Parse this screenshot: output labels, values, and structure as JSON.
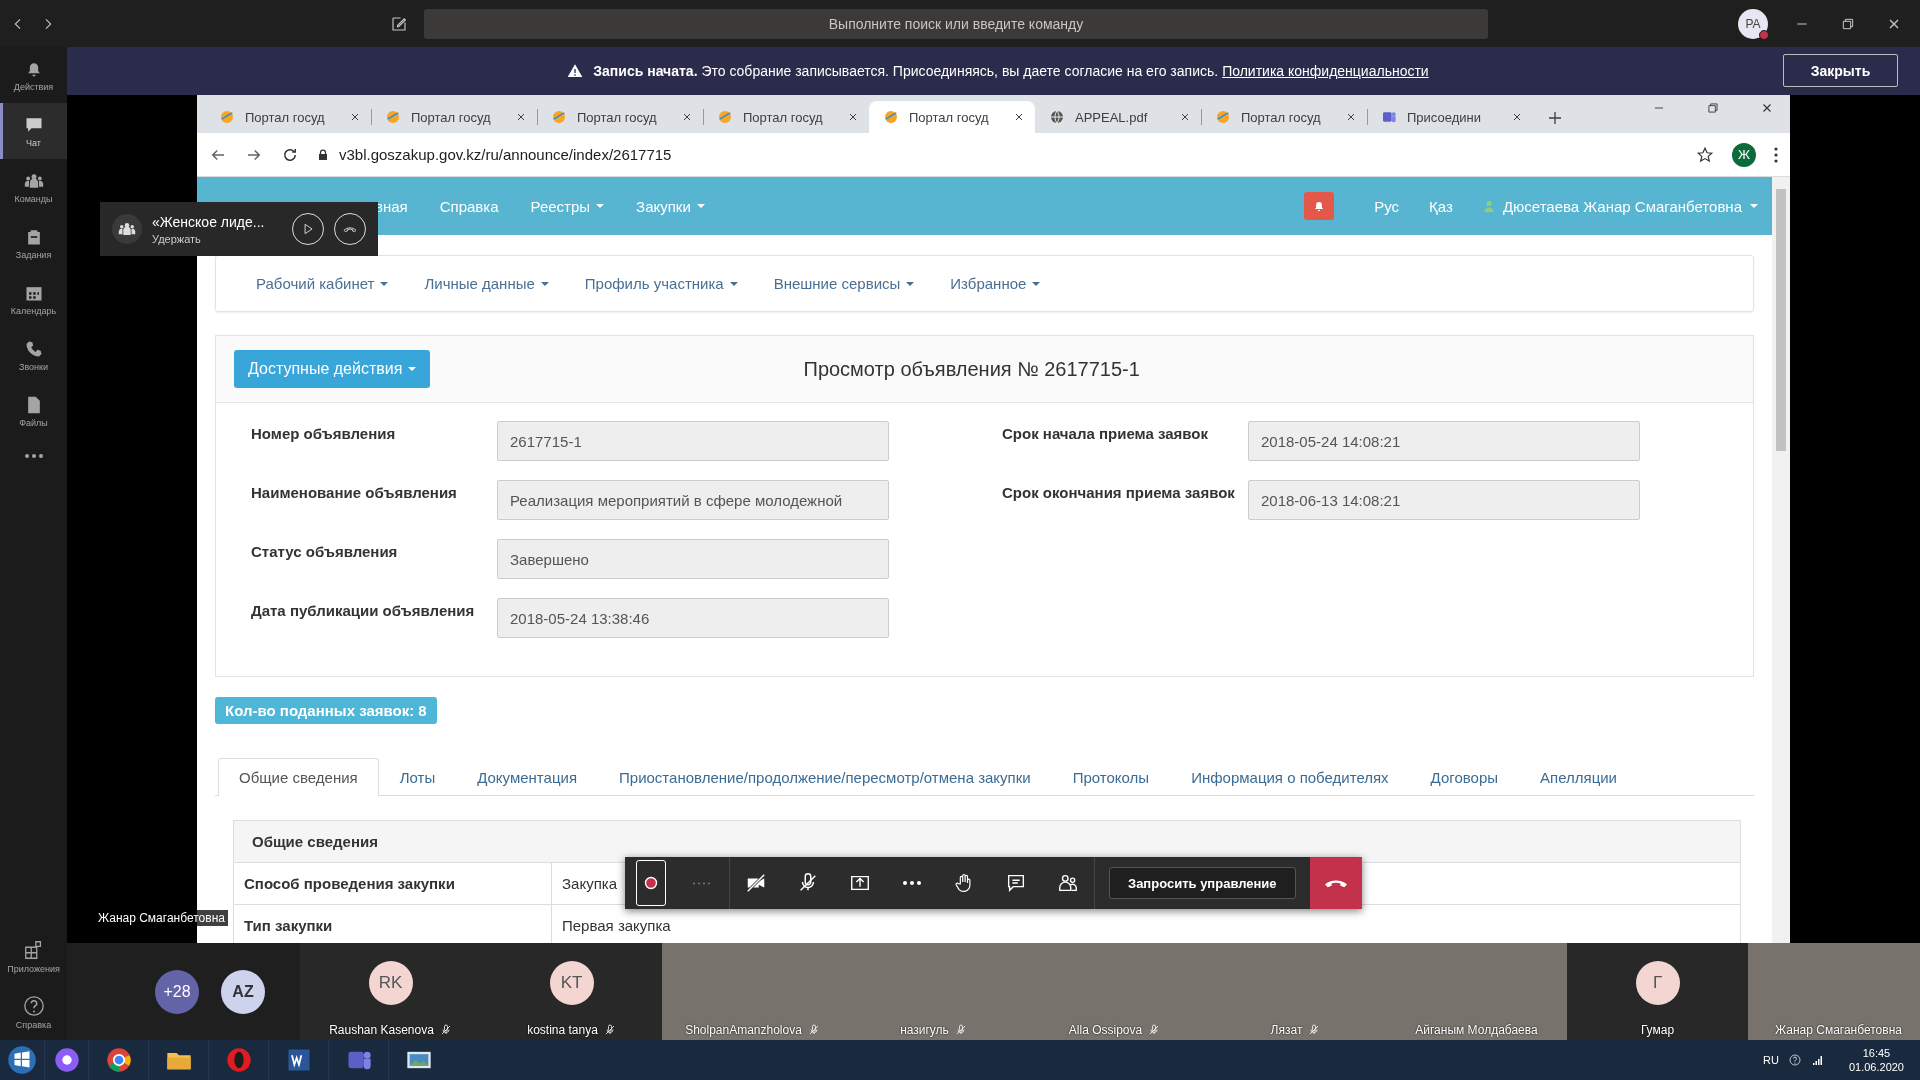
{
  "titlebar": {
    "search_placeholder": "Выполните поиск или введите команду",
    "avatar": "PA"
  },
  "banner": {
    "text": "**Запись начата.** Это собрание записывается. Присоединяясь, вы даете согласие на его запись.",
    "link": "Политика конфиденциальности",
    "button": "Закрыть"
  },
  "rail": {
    "items": [
      {
        "kind": "bell",
        "label": "Действия",
        "selected": false
      },
      {
        "kind": "chat",
        "label": "Чат",
        "selected": true
      },
      {
        "kind": "teams",
        "label": "Команды",
        "selected": false
      },
      {
        "kind": "tasks",
        "label": "Задания",
        "selected": false
      },
      {
        "kind": "calendar",
        "label": "Календарь",
        "selected": false
      },
      {
        "kind": "calls",
        "label": "Звонки",
        "selected": false
      },
      {
        "kind": "files",
        "label": "Файлы",
        "selected": false
      }
    ],
    "bottom": [
      {
        "kind": "apps",
        "label": "Приложения"
      },
      {
        "kind": "help",
        "label": "Справка"
      }
    ]
  },
  "call_pill": {
    "title": "«Женское лиде...",
    "subtitle": "Удержать"
  },
  "stage_name": "Жанар Смаганбетовна",
  "browser": {
    "tabs": [
      {
        "kind": "portal",
        "title": "Портал госуд",
        "selected": false
      },
      {
        "kind": "portal",
        "title": "Портал госуд",
        "selected": false
      },
      {
        "kind": "portal",
        "title": "Портал госуд",
        "selected": false
      },
      {
        "kind": "portal",
        "title": "Портал госуд",
        "selected": false
      },
      {
        "kind": "portal",
        "title": "Портал госуд",
        "selected": true
      },
      {
        "kind": "globe",
        "title": "APPEAL.pdf",
        "selected": false
      },
      {
        "kind": "portal",
        "title": "Портал госуд",
        "selected": false
      },
      {
        "kind": "teams",
        "title": "Присоедини",
        "selected": false
      }
    ],
    "url": "v3bl.goszakup.gov.kz/ru/announce/index/2617715",
    "profile": "Ж"
  },
  "portal": {
    "nav": [
      {
        "label": "вная",
        "dropdown": false
      },
      {
        "label": "Справка",
        "dropdown": false
      },
      {
        "label": "Реестры",
        "dropdown": true
      },
      {
        "label": "Закупки",
        "dropdown": true
      }
    ],
    "langs": [
      "Рус",
      "Қаз"
    ],
    "user": "Дюсетаева Жанар Смаганбетовна",
    "subnav": [
      "Рабочий кабинет",
      "Личные данные",
      "Профиль участника",
      "Внешние сервисы",
      "Избранное"
    ],
    "actions_button": "Доступные действия",
    "title": "Просмотр объявления № 2617715-1",
    "fields_left": [
      {
        "label": "Номер объявления",
        "value": "2617715-1"
      },
      {
        "label": "Наименование объявления",
        "value": "Реализация мероприятий в сфере молодежной"
      },
      {
        "label": "Статус объявления",
        "value": "Завершено"
      },
      {
        "label": "Дата публикации объявления",
        "value": "2018-05-24 13:38:46"
      }
    ],
    "fields_right": [
      {
        "label": "Срок начала приема заявок",
        "value": "2018-05-24 14:08:21"
      },
      {
        "label": "Срок окончания приема заявок",
        "value": "2018-06-13 14:08:21"
      }
    ],
    "count_badge": "Кол-во поданных заявок: 8",
    "tabs": [
      {
        "label": "Общие сведения",
        "selected": true
      },
      {
        "label": "Лоты",
        "selected": false
      },
      {
        "label": "Документация",
        "selected": false
      },
      {
        "label": "Приостановление/продолжение/пересмотр/отмена закупки",
        "selected": false
      },
      {
        "label": "Протоколы",
        "selected": false
      },
      {
        "label": "Информация о победителях",
        "selected": false
      },
      {
        "label": "Договоры",
        "selected": false
      },
      {
        "label": "Апелляции",
        "selected": false
      }
    ],
    "table": {
      "heading": "Общие сведения",
      "rows": [
        {
          "label": "Способ проведения закупки",
          "value": "Закупка"
        },
        {
          "label": "Тип закупки",
          "value": "Первая закупка"
        }
      ]
    }
  },
  "meeting_toolbar": [
    {
      "kind": "record",
      "selected": true
    },
    {
      "kind": "dash",
      "selected": false
    },
    {
      "kind": "camera-off",
      "selected": false
    },
    {
      "kind": "mic-off",
      "selected": false
    },
    {
      "kind": "share",
      "selected": false
    },
    {
      "kind": "more",
      "selected": false
    },
    {
      "kind": "hand",
      "selected": false
    },
    {
      "kind": "chat",
      "selected": false
    },
    {
      "kind": "people",
      "selected": false
    },
    {
      "kind": "control",
      "label": "Запросить управление"
    },
    {
      "kind": "hangup"
    }
  ],
  "participants": {
    "bubbles": [
      "+28",
      "AZ"
    ],
    "tiles": [
      {
        "kind": "avatar",
        "initials": "RK",
        "name": "Raushan Kasenova",
        "muted": true
      },
      {
        "kind": "avatar",
        "initials": "KT",
        "name": "kostina tanya",
        "muted": true
      },
      {
        "kind": "video",
        "name": "SholpanAmanzholova",
        "muted": true
      },
      {
        "kind": "video",
        "name": "назигуль",
        "muted": true
      },
      {
        "kind": "video",
        "name": "Alla Ossipova",
        "muted": true
      },
      {
        "kind": "video",
        "name": "Лязат",
        "muted": true
      },
      {
        "kind": "video",
        "name": "Айганым Молдабаева",
        "muted": false
      },
      {
        "kind": "avatar",
        "initials": "Г",
        "name": "Гумар",
        "muted": false
      },
      {
        "kind": "video",
        "name": "Жанар Смаганбетовна",
        "muted": false
      }
    ]
  },
  "taskbar": {
    "apps": [
      {
        "kind": "alice"
      },
      {
        "kind": "chrome"
      },
      {
        "kind": "explorer"
      },
      {
        "kind": "opera"
      },
      {
        "kind": "word"
      },
      {
        "kind": "teams"
      },
      {
        "kind": "viewer"
      }
    ],
    "lang": "RU",
    "time": "16:45",
    "date": "01.06.2020"
  }
}
